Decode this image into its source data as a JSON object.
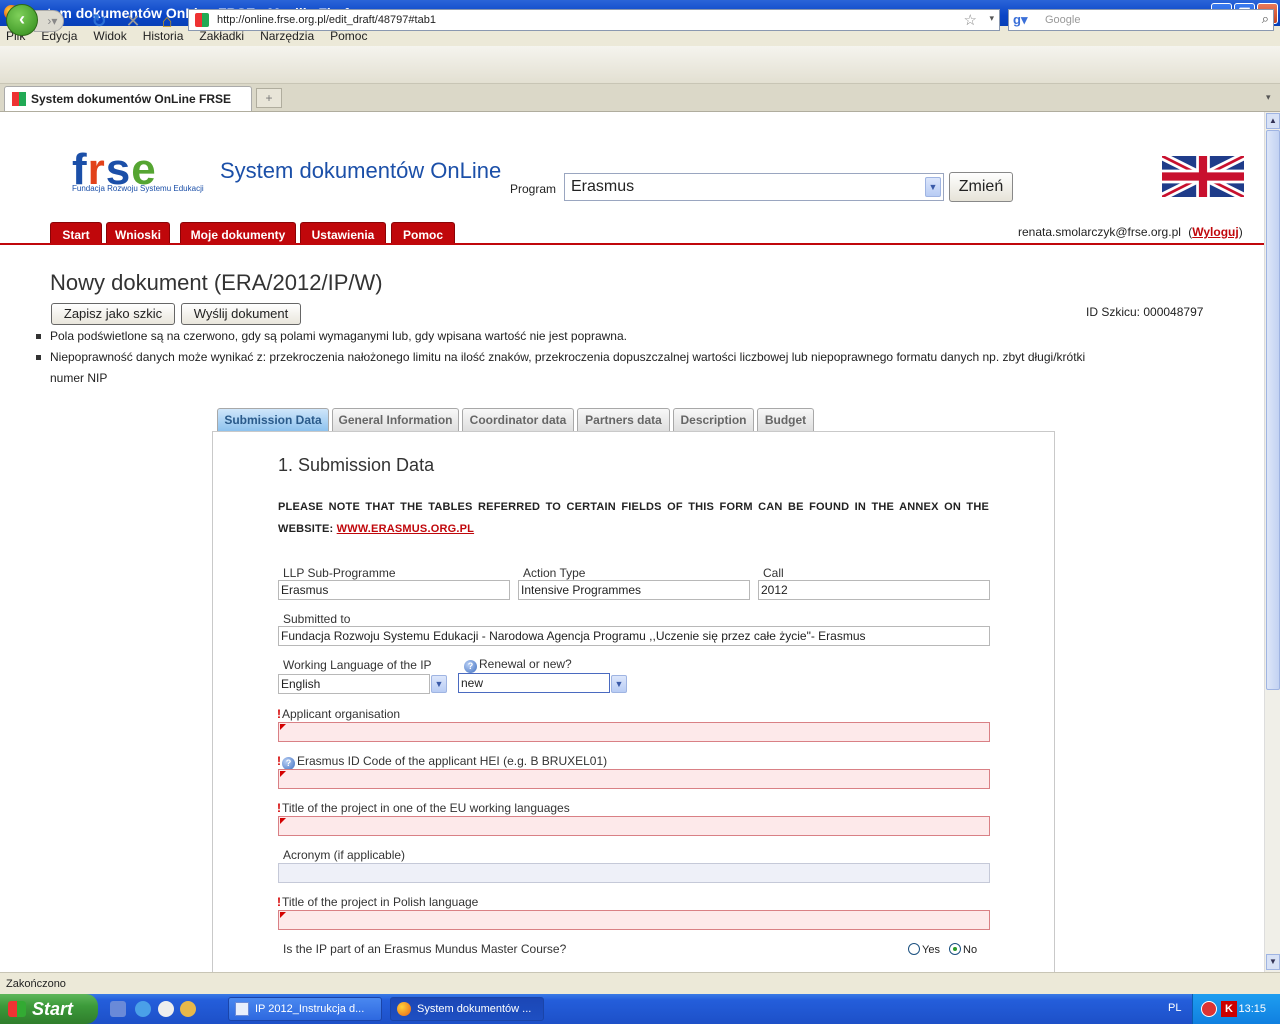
{
  "window": {
    "title": "System dokumentów OnLine FRSE - Mozilla Firefox"
  },
  "menu": [
    "Plik",
    "Edycja",
    "Widok",
    "Historia",
    "Zakładki",
    "Narzędzia",
    "Pomoc"
  ],
  "nav": {
    "url": "http://online.frse.org.pl/edit_draft/48797#tab1",
    "search_placeholder": "Google"
  },
  "browser_tab": {
    "label": "System dokumentów OnLine FRSE"
  },
  "status": {
    "text": "Zakończono"
  },
  "taskbar": {
    "start": "Start",
    "items": [
      "IP 2012_Instrukcja d...",
      "System dokumentów ..."
    ],
    "lang": "PL",
    "clock": "13:15"
  },
  "header": {
    "logo": {
      "f": "f",
      "r": "r",
      "s": "s",
      "e": "e",
      "subtitle": "Fundacja Rozwoju Systemu Edukacji"
    },
    "title": "System dokumentów OnLine",
    "program_label": "Program",
    "program_value": "Erasmus",
    "change_button": "Zmień"
  },
  "tabs": [
    "Start",
    "Wnioski",
    "Moje dokumenty",
    "Ustawienia",
    "Pomoc"
  ],
  "user": {
    "email": "renata.smolarczyk@frse.org.pl",
    "open": "(",
    "logout": "Wyloguj",
    "close": ")"
  },
  "document": {
    "title": "Nowy dokument (ERA/2012/IP/W)",
    "save_draft": "Zapisz jako szkic",
    "send": "Wyślij dokument",
    "draft_id": "ID Szkicu: 000048797",
    "notes": [
      "Pola podświetlone są na czerwono, gdy są polami wymaganymi lub, gdy wpisana wartość nie jest poprawna.",
      "Niepoprawność danych może wynikać z: przekroczenia nałożonego limitu na ilość znaków, przekroczenia dopuszczalnej wartości liczbowej lub niepoprawnego formatu danych np. zbyt długi/krótki",
      "numer NIP"
    ]
  },
  "form_tabs": [
    "Submission Data",
    "General Information",
    "Coordinator data",
    "Partners data",
    "Description",
    "Budget"
  ],
  "form": {
    "section_title": "1. Submission Data",
    "note": "PLEASE NOTE THAT THE TABLES REFERRED TO CERTAIN FIELDS OF THIS FORM CAN BE FOUND IN THE ANNEX ON THE WEBSITE:",
    "note_link": "WWW.ERASMUS.ORG.PL",
    "fields": {
      "llp_label": "LLP Sub-Programme",
      "llp_value": "Erasmus",
      "action_label": "Action Type",
      "action_value": "Intensive Programmes",
      "call_label": "Call",
      "call_value": "2012",
      "submitted_label": "Submitted to",
      "submitted_value": "Fundacja Rozwoju Systemu Edukacji - Narodowa Agencja Programu ,,Uczenie się przez całe życie\"- Erasmus",
      "lang_label": "Working Language of the IP",
      "lang_value": "English",
      "renewal_label": "Renewal or new?",
      "renewal_value": "new",
      "applicant_label": "Applicant organisation",
      "erasmus_id_label": "Erasmus ID Code of the applicant HEI (e.g. B BRUXEL01)",
      "title_eu_label": "Title of the project in one of the EU working languages",
      "acronym_label": "Acronym (if applicable)",
      "title_pl_label": "Title of the project in Polish language",
      "mundus_label": "Is the IP part of an Erasmus Mundus Master Course?",
      "yes": "Yes",
      "no": "No",
      "mundus_selected": "No"
    }
  },
  "colors": {
    "accent_red": "#c0070b",
    "brand_blue": "#1b4fa8",
    "required_bg": "#fde9ea"
  },
  "icons": [
    "firefox-icon",
    "back-arrow-icon",
    "forward-arrow-icon",
    "reload-icon",
    "stop-icon",
    "home-icon",
    "star-icon",
    "google-icon",
    "magnifier-icon",
    "uk-flag-icon",
    "help-icon"
  ]
}
